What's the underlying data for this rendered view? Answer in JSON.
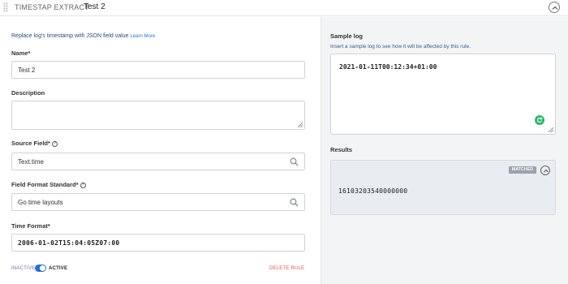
{
  "header": {
    "rule_type": "TIMESTAP EXTRACT",
    "rule_name": "Test 2"
  },
  "form": {
    "description_text": "Replace log's timestamp with JSON field value",
    "learn_more": "Learn More",
    "name_label": "Name*",
    "name_value": "Test 2",
    "description_label": "Description",
    "description_value": "",
    "source_field_label": "Source Field*",
    "source_field_value": "Text.time",
    "format_standard_label": "Field Format Standard*",
    "format_standard_value": "Go time layouts",
    "time_format_label": "Time Format*",
    "time_format_value": "2006-01-02T15:04:05Z07:00",
    "toggle_inactive": "INACTIVE",
    "toggle_active": "ACTIVE",
    "toggle_state": "active",
    "delete_rule": "DELETE RULE"
  },
  "sample": {
    "label": "Sample log",
    "hint": "Insert a sample log to see how it will be affected by this rule.",
    "value": "2021-01-11T00:12:34+01:00"
  },
  "results": {
    "label": "Results",
    "badge": "MATCHED",
    "value": "16103203540000000"
  },
  "colors": {
    "accent": "#2a6fdb",
    "delete": "#e0564b",
    "refresh": "#2db46f"
  }
}
